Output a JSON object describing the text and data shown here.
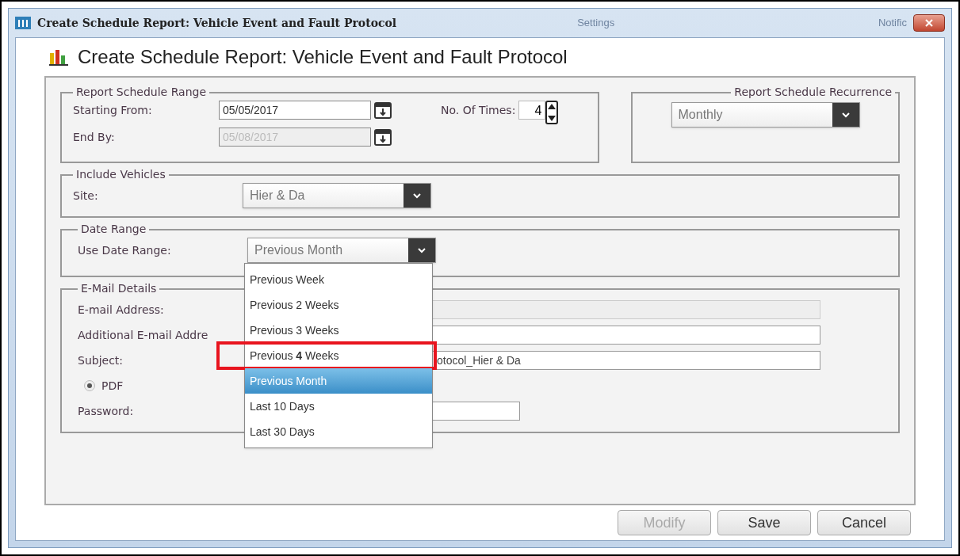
{
  "background_tabs": [
    "Settings",
    "Notific"
  ],
  "window": {
    "title": "Create Schedule Report: Vehicle Event and Fault Protocol"
  },
  "heading": "Create Schedule Report: Vehicle Event and Fault Protocol",
  "report_schedule_range": {
    "legend": "Report Schedule Range",
    "starting_from": {
      "label": "Starting From:",
      "value": "05/05/2017",
      "disabled": false
    },
    "end_by": {
      "label": "End By:",
      "value": "05/08/2017",
      "disabled": true
    },
    "no_of_times": {
      "label": "No. Of Times:",
      "value": "4"
    }
  },
  "report_schedule_recurrence": {
    "legend": "Report Schedule Recurrence",
    "value": "Monthly"
  },
  "include_vehicles": {
    "legend": "Include Vehicles",
    "site": {
      "label": "Site:",
      "value": "Hier & Da"
    }
  },
  "date_range": {
    "legend": "Date Range",
    "label": "Use Date Range:",
    "value": "Previous Month",
    "expanded": true,
    "options": [
      {
        "label": "Previous Week",
        "selected": false,
        "annotated": false
      },
      {
        "label": "Previous 2 Weeks",
        "selected": false,
        "annotated": false
      },
      {
        "label": "Previous 3 Weeks",
        "selected": false,
        "annotated": false
      },
      {
        "label": "Previous **4** Weeks",
        "selected": false,
        "annotated": true
      },
      {
        "label": "Previous Month",
        "selected": true,
        "annotated": false
      },
      {
        "label": "Last 10 Days",
        "selected": false,
        "annotated": false
      },
      {
        "label": "Last 30 Days",
        "selected": false,
        "annotated": false
      }
    ]
  },
  "email_details": {
    "legend": "E-Mail Details",
    "fields": [
      {
        "kind": "text",
        "label": "E-mail Address:",
        "disabled": true
      },
      {
        "kind": "text",
        "label": "Additional E-mail Addre",
        "disabled": false
      },
      {
        "kind": "text",
        "label": "Subject:",
        "value": "otocol_Hier & Da",
        "disabled": false
      },
      {
        "kind": "radio",
        "label": "PDF",
        "checked": true
      },
      {
        "kind": "password",
        "label": "Password:",
        "disabled": false
      }
    ]
  },
  "buttons": [
    {
      "label": "Modify",
      "disabled": true
    },
    {
      "label": "Save",
      "disabled": false
    },
    {
      "label": "Cancel",
      "disabled": false
    }
  ]
}
